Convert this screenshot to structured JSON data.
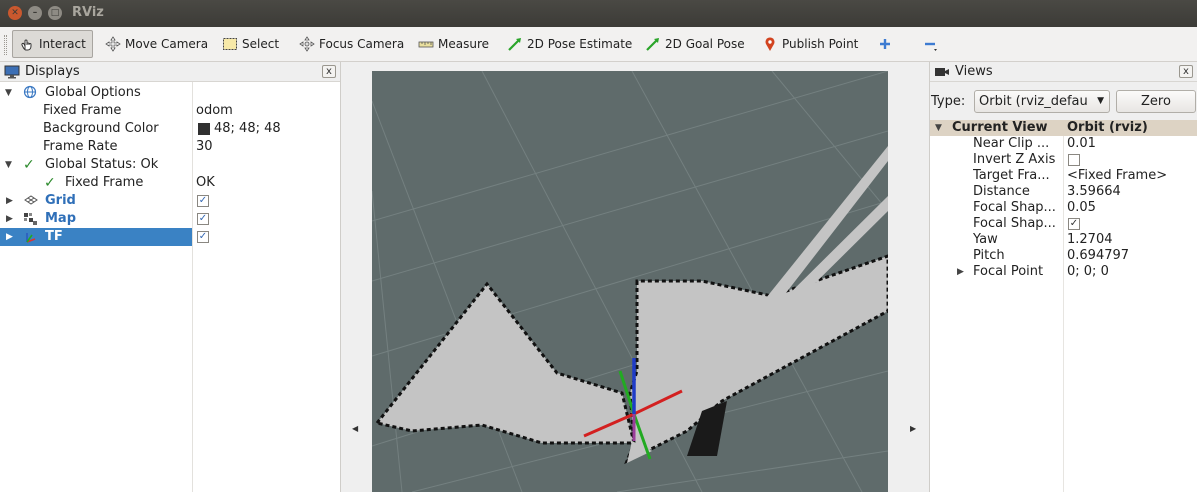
{
  "window": {
    "title": "RViz"
  },
  "toolbar": {
    "interact": "Interact",
    "move_camera": "Move Camera",
    "select": "Select",
    "focus_camera": "Focus Camera",
    "measure": "Measure",
    "pose_estimate": "2D Pose Estimate",
    "goal_pose": "2D Goal Pose",
    "publish_point": "Publish Point"
  },
  "displays": {
    "title": "Displays",
    "close": "x",
    "global_options": "Global Options",
    "fixed_frame_label": "Fixed Frame",
    "fixed_frame_value": "odom",
    "bg_color_label": "Background Color",
    "bg_color_value": "48; 48; 48",
    "frame_rate_label": "Frame Rate",
    "frame_rate_value": "30",
    "global_status": "Global Status: Ok",
    "status_fixed_frame_label": "Fixed Frame",
    "status_fixed_frame_value": "OK",
    "grid": "Grid",
    "map": "Map",
    "tf": "TF"
  },
  "views": {
    "title": "Views",
    "close": "x",
    "type_label": "Type:",
    "type_value": "Orbit (rviz_defau",
    "zero_button": "Zero",
    "header_label": "Current View",
    "header_value": "Orbit (rviz)",
    "near_clip_label": "Near Clip ...",
    "near_clip_value": "0.01",
    "invert_z_label": "Invert Z Axis",
    "target_frame_label": "Target Fra...",
    "target_frame_value": "<Fixed Frame>",
    "distance_label": "Distance",
    "distance_value": "3.59664",
    "focal_shape1_label": "Focal Shap...",
    "focal_shape1_value": "0.05",
    "focal_shape2_label": "Focal Shap...",
    "yaw_label": "Yaw",
    "yaw_value": "1.2704",
    "pitch_label": "Pitch",
    "pitch_value": "0.694797",
    "focal_point_label": "Focal Point",
    "focal_point_value": "0; 0; 0"
  },
  "colors": {
    "background_swatch": "#303030",
    "selection": "#3a82c4",
    "viewport_bg": "#5f6b6b",
    "map_free": "#c8c8c8"
  }
}
